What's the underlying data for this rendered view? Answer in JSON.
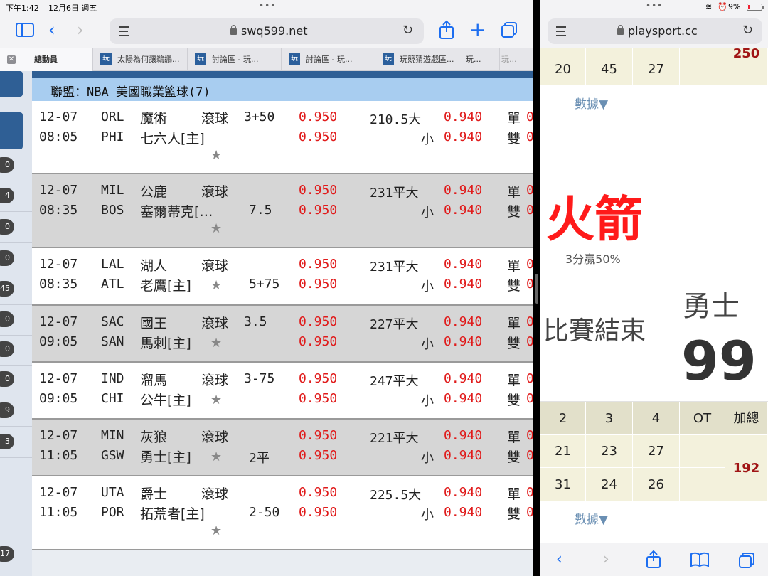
{
  "status_left": {
    "time": "下午1:42",
    "date": "12月6日 週五"
  },
  "status_right": {
    "battery": "9%"
  },
  "left_browser": {
    "url": "swq599.net",
    "tabs": [
      {
        "label": "總動員"
      },
      {
        "label": "太陽為何讓鵜鶘..."
      },
      {
        "label": "討論區 - 玩..."
      },
      {
        "label": "討論區 - 玩..."
      },
      {
        "label": "玩競猜遊戲區..."
      },
      {
        "label": "玩..."
      },
      {
        "label": "玩..."
      }
    ],
    "tab_badge": "玩",
    "league": "聯盟：NBA 美國職業籃球(7)",
    "side_pills": [
      "0",
      "4",
      "0",
      "0",
      "45",
      "0",
      "0",
      "0",
      "9",
      "3",
      "17"
    ],
    "games": [
      {
        "date": "12-07",
        "time": "08:05",
        "code1": "ORL",
        "team1": "魔術",
        "code2": "PHI",
        "team2": "七六人[主]",
        "live": "滾球",
        "handicap": "3+50",
        "handicap2": "",
        "odds1": "0.950",
        "odds2": "0.950",
        "total_line": "210.5大",
        "total_under": "小",
        "total_odds1": "0.940",
        "total_odds2": "0.940",
        "odd_label": "單",
        "even_label": "雙",
        "odd_val": "0",
        "even_val": "0"
      },
      {
        "date": "12-07",
        "time": "08:35",
        "code1": "MIL",
        "team1": "公鹿",
        "code2": "BOS",
        "team2": "塞爾蒂克[…",
        "live": "滾球",
        "handicap": "",
        "handicap2": "7.5",
        "odds1": "0.950",
        "odds2": "0.950",
        "total_line": "231平大",
        "total_under": "小",
        "total_odds1": "0.940",
        "total_odds2": "0.940",
        "odd_label": "單",
        "even_label": "雙",
        "odd_val": "0",
        "even_val": "0"
      },
      {
        "date": "12-07",
        "time": "08:35",
        "code1": "LAL",
        "team1": "湖人",
        "code2": "ATL",
        "team2": "老鷹[主]",
        "live": "滾球",
        "handicap": "",
        "handicap2": "5+75",
        "odds1": "0.950",
        "odds2": "0.950",
        "total_line": "231平大",
        "total_under": "小",
        "total_odds1": "0.940",
        "total_odds2": "0.940",
        "odd_label": "單",
        "even_label": "雙",
        "odd_val": "0",
        "even_val": "0"
      },
      {
        "date": "12-07",
        "time": "09:05",
        "code1": "SAC",
        "team1": "國王",
        "code2": "SAN",
        "team2": "馬刺[主]",
        "live": "滾球",
        "handicap": "3.5",
        "handicap2": "",
        "odds1": "0.950",
        "odds2": "0.950",
        "total_line": "227平大",
        "total_under": "小",
        "total_odds1": "0.940",
        "total_odds2": "0.940",
        "odd_label": "單",
        "even_label": "雙",
        "odd_val": "0",
        "even_val": "0"
      },
      {
        "date": "12-07",
        "time": "09:05",
        "code1": "IND",
        "team1": "溜馬",
        "code2": "CHI",
        "team2": "公牛[主]",
        "live": "滾球",
        "handicap": "3-75",
        "handicap2": "",
        "odds1": "0.950",
        "odds2": "0.950",
        "total_line": "247平大",
        "total_under": "小",
        "total_odds1": "0.940",
        "total_odds2": "0.940",
        "odd_label": "單",
        "even_label": "雙",
        "odd_val": "0",
        "even_val": "0"
      },
      {
        "date": "12-07",
        "time": "11:05",
        "code1": "MIN",
        "team1": "灰狼",
        "code2": "GSW",
        "team2": "勇士[主]",
        "live": "滾球",
        "handicap": "",
        "handicap2": "2平",
        "odds1": "0.950",
        "odds2": "0.950",
        "total_line": "221平大",
        "total_under": "小",
        "total_odds1": "0.940",
        "total_odds2": "0.940",
        "odd_label": "單",
        "even_label": "雙",
        "odd_val": "0",
        "even_val": "0"
      },
      {
        "date": "12-07",
        "time": "11:05",
        "code1": "UTA",
        "team1": "爵士",
        "code2": "POR",
        "team2": "拓荒者[主]",
        "live": "滾球",
        "handicap": "",
        "handicap2": "2-50",
        "odds1": "0.950",
        "odds2": "0.950",
        "total_line": "225.5大",
        "total_under": "小",
        "total_odds1": "0.940",
        "total_odds2": "0.940",
        "odd_label": "單",
        "even_label": "雙",
        "odd_val": "0",
        "even_val": "0"
      }
    ]
  },
  "right_browser": {
    "url": "playsport.cc",
    "top_scores": [
      "20",
      "45",
      "27",
      ""
    ],
    "top_total": "250",
    "data_link": "數據▼",
    "team_home": "火箭",
    "team_home_sub": "3分贏50%",
    "game_status": "比賽結束",
    "team_away": "勇士",
    "score_away": "99",
    "quarter_headers": [
      "2",
      "3",
      "4",
      "OT",
      "加總"
    ],
    "row1": [
      "21",
      "23",
      "27",
      ""
    ],
    "row2": [
      "31",
      "24",
      "26",
      ""
    ],
    "total2": "192"
  }
}
